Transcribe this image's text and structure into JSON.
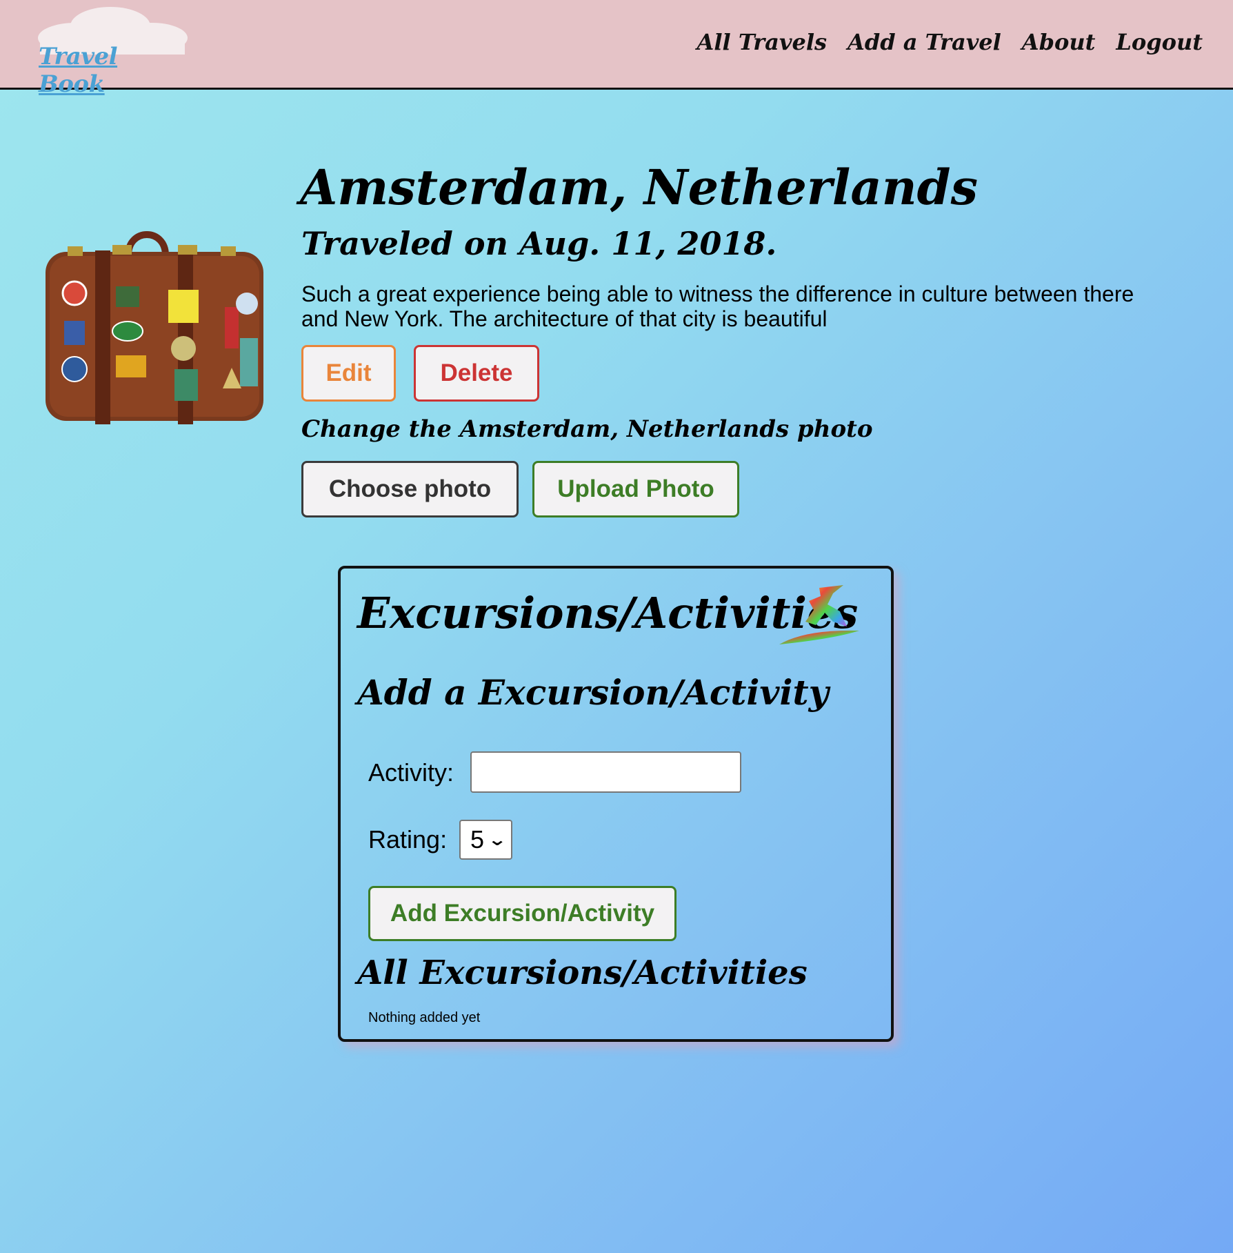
{
  "nav": {
    "logo_text": "Travel Book",
    "links": [
      "All Travels",
      "Add a Travel",
      "About",
      "Logout"
    ]
  },
  "travel": {
    "title": "Amsterdam, Netherlands",
    "traveled_on": "Traveled on Aug. 11, 2018.",
    "description": "Such a great experience being able to witness the difference in culture between there and New York. The architecture of that city is beautiful",
    "edit_label": "Edit",
    "delete_label": "Delete",
    "change_photo_heading": "Change the Amsterdam, Netherlands photo",
    "choose_photo_label": "Choose photo",
    "upload_photo_label": "Upload Photo"
  },
  "excursions": {
    "title": "Excursions/Activities",
    "add_heading": "Add a Excursion/Activity",
    "activity_label": "Activity:",
    "activity_value": "",
    "rating_label": "Rating:",
    "rating_value": "5",
    "add_button_label": "Add Excursion/Activity",
    "all_heading": "All Excursions/Activities",
    "empty_text": "Nothing added yet"
  },
  "colors": {
    "nav_bg": "#e5c3c7",
    "edit": "#e9853a",
    "delete": "#cc3434",
    "upload": "#3d7d26",
    "logo": "#4aa1d4"
  },
  "icons": [
    "suitcase-image",
    "surfer-icon",
    "cloud-icon",
    "chevron-down-icon"
  ]
}
